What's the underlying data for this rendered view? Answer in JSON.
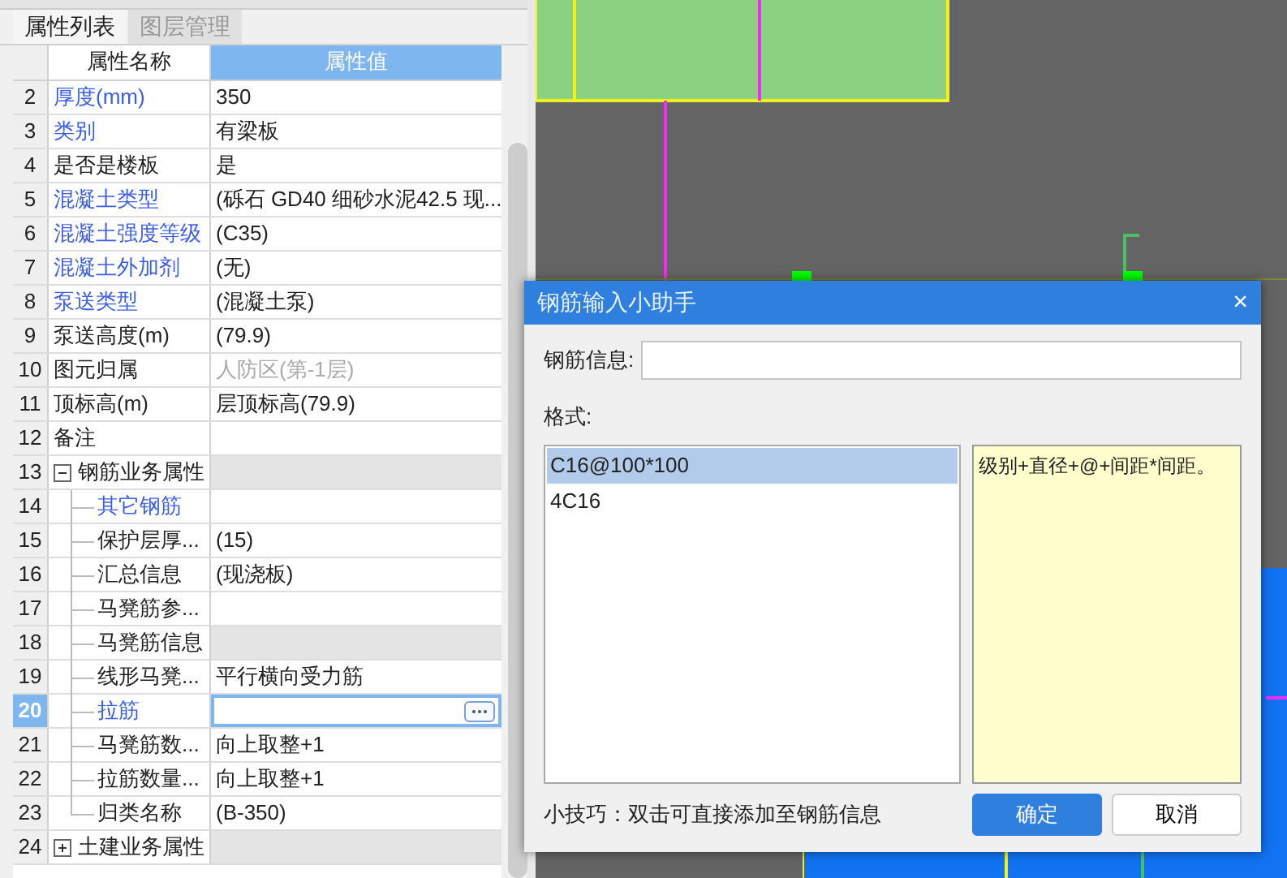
{
  "panel": {
    "tabs": [
      {
        "label": "属性列表",
        "selected": true
      },
      {
        "label": "图层管理",
        "selected": false
      }
    ],
    "table": {
      "columns": [
        "属性名称",
        "属性值"
      ],
      "rows": [
        {
          "number": "2",
          "name": "厚度(mm)",
          "value": "350",
          "kind": "property",
          "link": true,
          "disabled": false,
          "shaded": false,
          "selected": false
        },
        {
          "number": "3",
          "name": "类别",
          "value": "有梁板",
          "kind": "property",
          "link": true,
          "disabled": false,
          "shaded": false,
          "selected": false
        },
        {
          "number": "4",
          "name": "是否是楼板",
          "value": "是",
          "kind": "property",
          "link": false,
          "disabled": false,
          "shaded": false,
          "selected": false
        },
        {
          "number": "5",
          "name": "混凝土类型",
          "value": "(砾石 GD40 细砂水泥42.5  现...",
          "kind": "property",
          "link": true,
          "disabled": false,
          "shaded": false,
          "selected": false
        },
        {
          "number": "6",
          "name": "混凝土强度等级",
          "value": "(C35)",
          "kind": "property",
          "link": true,
          "disabled": false,
          "shaded": false,
          "selected": false
        },
        {
          "number": "7",
          "name": "混凝土外加剂",
          "value": "(无)",
          "kind": "property",
          "link": true,
          "disabled": false,
          "shaded": false,
          "selected": false
        },
        {
          "number": "8",
          "name": "泵送类型",
          "value": "(混凝土泵)",
          "kind": "property",
          "link": true,
          "disabled": false,
          "shaded": false,
          "selected": false
        },
        {
          "number": "9",
          "name": "泵送高度(m)",
          "value": "(79.9)",
          "kind": "property",
          "link": false,
          "disabled": false,
          "shaded": false,
          "selected": false
        },
        {
          "number": "10",
          "name": "图元归属",
          "value": "人防区(第-1层)",
          "kind": "property",
          "link": false,
          "disabled": true,
          "shaded": false,
          "selected": false
        },
        {
          "number": "11",
          "name": "顶标高(m)",
          "value": "层顶标高(79.9)",
          "kind": "property",
          "link": false,
          "disabled": false,
          "shaded": false,
          "selected": false
        },
        {
          "number": "12",
          "name": "备注",
          "kind": "property",
          "link": false,
          "shaded": false,
          "selected": false
        },
        {
          "number": "13",
          "name": "钢筋业务属性",
          "kind": "group",
          "expanded": true,
          "link": false,
          "shaded": true,
          "selected": false
        },
        {
          "number": "14",
          "name": "其它钢筋",
          "kind": "child",
          "link": true,
          "shaded": false,
          "selected": false
        },
        {
          "number": "15",
          "name": "保护层厚...",
          "value": "(15)",
          "kind": "child",
          "link": false,
          "disabled": false,
          "shaded": false,
          "selected": false
        },
        {
          "number": "16",
          "name": "汇总信息",
          "value": "(现浇板)",
          "kind": "child",
          "link": false,
          "disabled": false,
          "shaded": false,
          "selected": false
        },
        {
          "number": "17",
          "name": "马凳筋参...",
          "kind": "child",
          "link": false,
          "shaded": false,
          "selected": false
        },
        {
          "number": "18",
          "name": "马凳筋信息",
          "kind": "child",
          "link": false,
          "shaded": true,
          "selected": false
        },
        {
          "number": "19",
          "name": "线形马凳...",
          "value": "平行横向受力筋",
          "kind": "child",
          "link": false,
          "disabled": false,
          "shaded": false,
          "selected": false
        },
        {
          "number": "20",
          "name": "拉筋",
          "kind": "child",
          "link": true,
          "shaded": false,
          "selected": true
        },
        {
          "number": "21",
          "name": "马凳筋数...",
          "value": "向上取整+1",
          "kind": "child",
          "link": false,
          "disabled": false,
          "shaded": false,
          "selected": false
        },
        {
          "number": "22",
          "name": "拉筋数量...",
          "value": "向上取整+1",
          "kind": "child",
          "link": false,
          "disabled": false,
          "shaded": false,
          "selected": false
        },
        {
          "number": "23",
          "name": "归类名称",
          "value": "(B-350)",
          "kind": "child",
          "link": false,
          "disabled": false,
          "shaded": false,
          "selected": false
        },
        {
          "number": "24",
          "name": "土建业务属性",
          "kind": "group",
          "expanded": false,
          "link": false,
          "shaded": true,
          "selected": false
        }
      ]
    }
  },
  "dialog": {
    "title": "钢筋输入小助手",
    "close": "×",
    "field_label": "钢筋信息:",
    "format_label": "格式:",
    "formats": [
      {
        "label": "C16@100*100",
        "selected": true
      },
      {
        "label": "4C16",
        "selected": false
      }
    ],
    "description": "级别+直径+@+间距*间距。",
    "tip": "小技巧：双击可直接添加至钢筋信息",
    "buttons": [
      "确定",
      "取消"
    ]
  }
}
